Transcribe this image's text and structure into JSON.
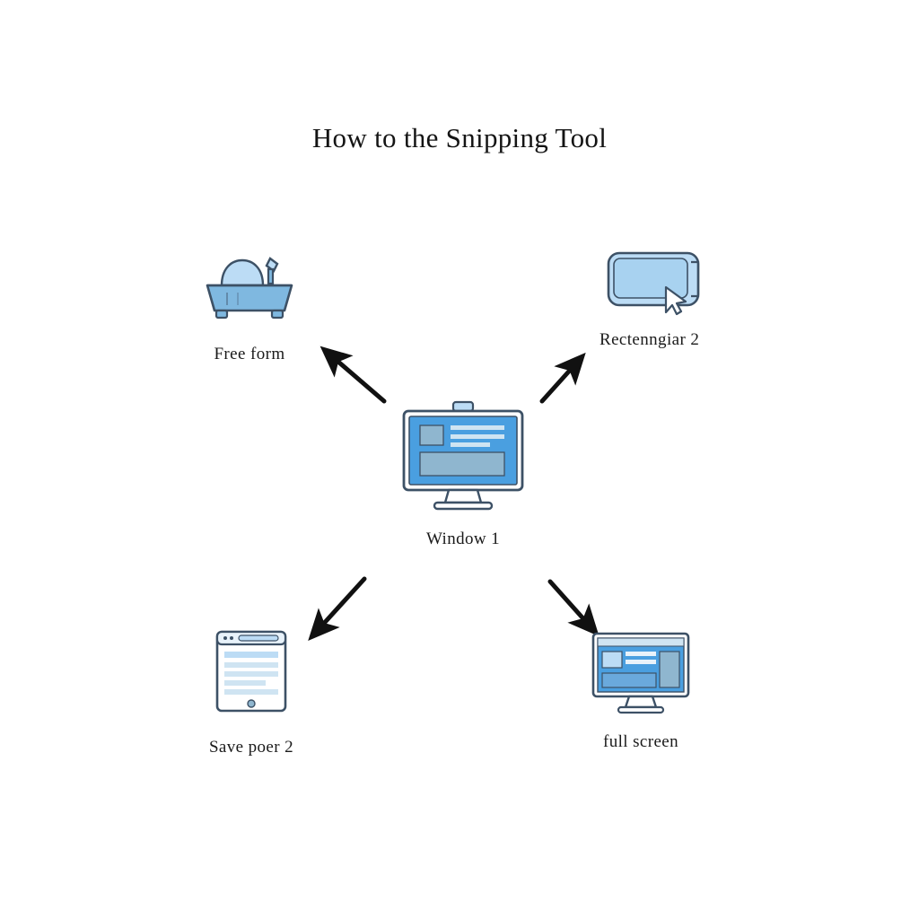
{
  "title": "How to the Snipping Tool",
  "colors": {
    "fill_light": "#bcdcf5",
    "fill_mid": "#7fb8e0",
    "fill_deep": "#4a9fe0",
    "stroke": "#3d5166",
    "arrow": "#111111",
    "text": "#1a1a1a",
    "background": "#ffffff"
  },
  "center_node": {
    "label": "Window 1",
    "icon": "desktop-monitor-icon"
  },
  "nodes": [
    {
      "id": "free-form",
      "label": "Free form",
      "icon": "scissors-snip-icon",
      "position": "top-left"
    },
    {
      "id": "rectangular",
      "label": "Rectenngiar  2",
      "icon": "rectangle-cursor-icon",
      "position": "top-right"
    },
    {
      "id": "save-poer",
      "label": "Save poer 2",
      "icon": "document-window-icon",
      "position": "bottom-left"
    },
    {
      "id": "full-screen",
      "label": "full screen",
      "icon": "monitor-fullscreen-icon",
      "position": "bottom-right"
    }
  ],
  "arrows": [
    {
      "id": "arrow-to-free-form",
      "from": "Window 1",
      "to": "Free form"
    },
    {
      "id": "arrow-to-rectangular",
      "from": "Window 1",
      "to": "Rectenngiar  2"
    },
    {
      "id": "arrow-to-save-poer",
      "from": "Window 1",
      "to": "Save poer 2"
    },
    {
      "id": "arrow-to-full-screen",
      "from": "Window 1",
      "to": "full screen"
    }
  ]
}
